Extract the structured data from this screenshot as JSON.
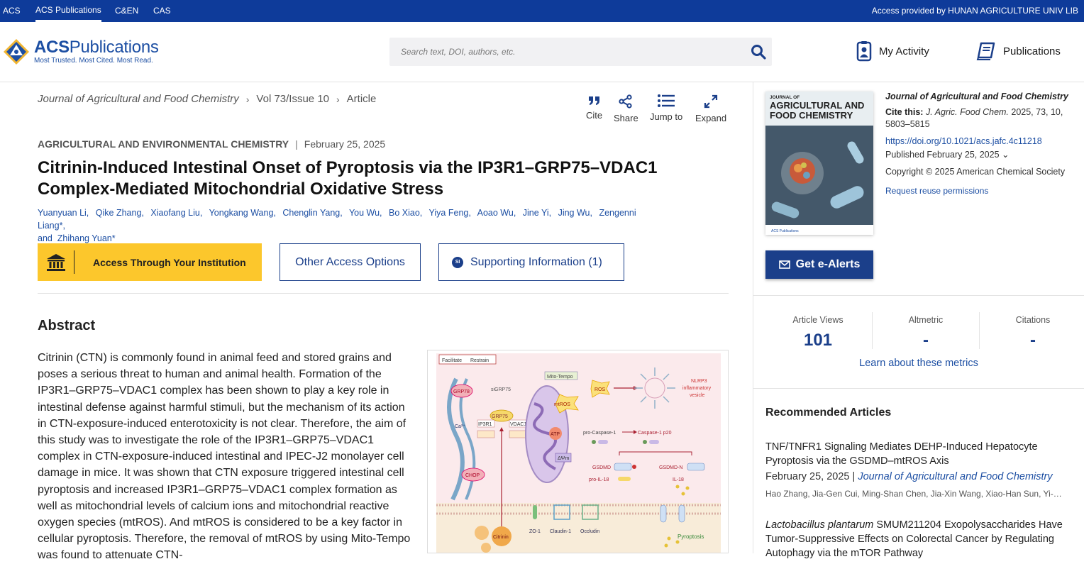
{
  "topbar": {
    "links": [
      "ACS",
      "ACS Publications",
      "C&EN",
      "CAS"
    ],
    "access": "Access provided by HUNAN AGRICULTURE UNIV LIB"
  },
  "header": {
    "brand_a": "ACS",
    "brand_b": "Publications",
    "tagline": "Most Trusted. Most Cited. Most Read.",
    "search_placeholder": "Search text, DOI, authors, etc.",
    "my_activity": "My Activity",
    "publications": "Publications"
  },
  "breadcrumb": {
    "journal": "Journal of Agricultural and Food Chemistry",
    "issue": "Vol 73/Issue 10",
    "type": "Article"
  },
  "tools": {
    "cite": "Cite",
    "share": "Share",
    "jump": "Jump to",
    "expand": "Expand"
  },
  "article": {
    "category": "AGRICULTURAL AND ENVIRONMENTAL CHEMISTRY",
    "date": "February 25, 2025",
    "title": "Citrinin-Induced Intestinal Onset of Pyroptosis via the IP3R1–GRP75–VDAC1 Complex-Mediated Mitochondrial Oxidative Stress",
    "authors": [
      "Yuanyuan Li,",
      "Qike Zhang,",
      "Xiaofang Liu,",
      "Yongkang Wang,",
      "Chenglin Yang,",
      "You Wu,",
      "Bo Xiao,",
      "Yiya Feng,",
      "Aoao Wu,",
      "Jine Yi,",
      "Jing Wu,",
      "Zengenni Liang*,"
    ],
    "authors_last": "and  Zhihang Yuan*"
  },
  "buttons": {
    "institution": "Access Through Your Institution",
    "other": "Other Access Options",
    "si_badge": "SI",
    "supporting": "Supporting Information (1)"
  },
  "abstract": {
    "heading": "Abstract",
    "text": "Citrinin (CTN) is commonly found in animal feed and stored grains and poses a serious threat to human and animal health. Formation of the IP3R1–GRP75–VDAC1 complex has been shown to play a key role in intestinal defense against harmful stimuli, but the mechanism of its action in CTN-exposure-induced enterotoxicity is not clear. Therefore, the aim of this study was to investigate the role of the IP3R1–GRP75–VDAC1 complex in CTN-exposure-induced intestinal and IPEC-J2 monolayer cell damage in mice. It was shown that CTN exposure triggered intestinal cell pyroptosis and increased IP3R1–GRP75–VDAC1 complex formation as well as mitochondrial levels of calcium ions and mitochondrial reactive oxygen species (mtROS). And mtROS is considered to be a key factor in cellular pyroptosis. Therefore, the removal of mtROS by using Mito-Tempo was found to attenuate CTN-"
  },
  "graphic": {
    "legend_a": "Facilitate",
    "legend_b": "Restrain",
    "grp78": "GRP78",
    "sigrp75": "siGRP75",
    "grp75": "GRP75",
    "ca": "Ca²⁺",
    "ip3r1": "IP3R1",
    "vdac1": "VDAC1",
    "chop": "CHOP",
    "mitotempo": "Mito-Tempo",
    "mtros": "mtROS",
    "ros": "ROS",
    "atp": "ATP",
    "dpsi": "ΔΨm",
    "nlrp3": "NLRP3",
    "inflam": "inflammatory",
    "vesicle": "vesicle",
    "procasp": "pro-Caspase-1",
    "casp": "Caspase-1 p20",
    "gsdmd": "GSDMD",
    "gsdmdn": "GSDMD-N",
    "proil": "pro-IL-18",
    "il": "IL-18",
    "zo1": "ZO-1",
    "claudin": "Claudin-1",
    "occludin": "Occludin",
    "citrinin": "Citrinin",
    "pyroptosis": "Pyroptosis"
  },
  "cover": {
    "line1": "JOURNAL OF",
    "line2": "AGRICULTURAL AND",
    "line3": "FOOD CHEMISTRY",
    "footer": "ACS Publications"
  },
  "sidebar": {
    "journal": "Journal of Agricultural and Food Chemistry",
    "cite_label": "Cite this:",
    "cite_journal": "J. Agric. Food Chem.",
    "cite_rest": " 2025, 73, 10, 5803–5815",
    "doi": "https://doi.org/10.1021/acs.jafc.4c11218",
    "published": "Published February 25, 2025",
    "copyright": "Copyright © 2025 American Chemical Society",
    "reuse": "Request reuse permissions",
    "ealerts": "Get e-Alerts"
  },
  "metrics": {
    "views_label": "Article Views",
    "views": "101",
    "alt_label": "Altmetric",
    "alt": "-",
    "cit_label": "Citations",
    "cit": "-",
    "learn": "Learn about these metrics"
  },
  "recommended": {
    "heading": "Recommended Articles",
    "a1_title": "TNF/TNFR1 Signaling Mediates DEHP-Induced Hepatocyte Pyroptosis via the GSDMD–mtROS Axis",
    "a1_date": "February 25, 2025",
    "a1_journal": "Journal of Agricultural and Food Chemistry",
    "a1_authors": "Hao Zhang, Jia-Gen Cui, Ming-Shan Chen, Jia-Xin Wang, Xiao-Han Sun, Yi-Xi Tang, and Jin-Long Li",
    "a2_italic": "Lactobacillus plantarum",
    "a2_title": " SMUM211204 Exopolysaccharides Have Tumor-Suppressive Effects on Colorectal Cancer by Regulating Autophagy via the mTOR Pathway"
  },
  "colors": {
    "topbar": "#0e3b9a",
    "accent": "#1b3f8a",
    "link": "#1d4fa3",
    "institution": "#fcc72c"
  }
}
